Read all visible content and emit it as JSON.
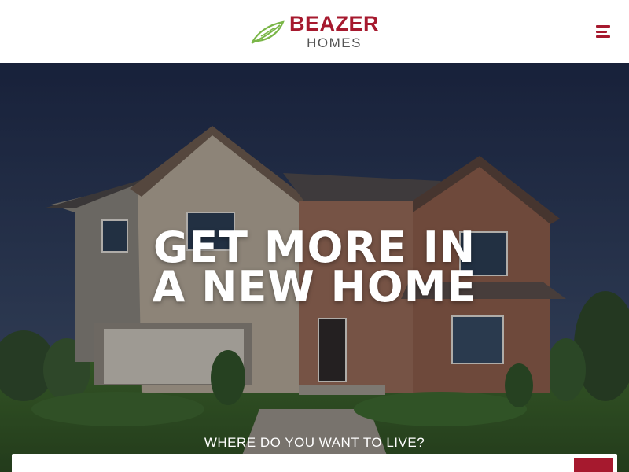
{
  "header": {
    "logo": {
      "primary": "BEAZER",
      "secondary": "HOMES"
    },
    "menu_icon": "hamburger-menu-icon"
  },
  "hero": {
    "headline_line1": "GET MORE IN",
    "headline_line2": "A NEW HOME",
    "search_label": "WHERE DO YOU WANT TO LIVE?",
    "search_placeholder": "",
    "search_icon": "search-icon"
  },
  "colors": {
    "brand": "#a6192e",
    "logo_leaf": "#7ab648",
    "logo_secondary": "#555555",
    "hero_text": "#ffffff"
  }
}
